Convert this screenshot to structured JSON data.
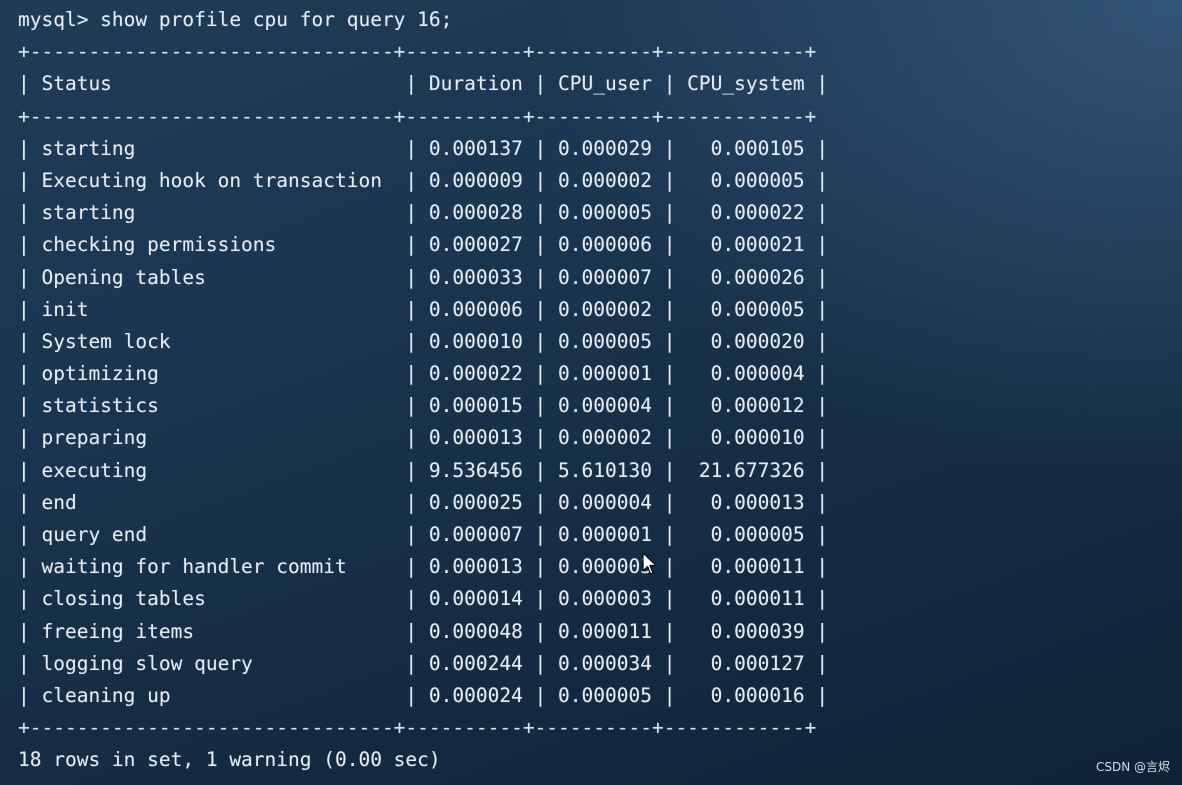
{
  "prompt_line": "mysql> show profile cpu for query 16;",
  "table": {
    "border": "+-------------------------------+----------+----------+------------+",
    "header": "| Status                         | Duration | CPU_user | CPU_system |",
    "rows": [
      "| starting                       | 0.000137 | 0.000029 |   0.000105 |",
      "| Executing hook on transaction  | 0.000009 | 0.000002 |   0.000005 |",
      "| starting                       | 0.000028 | 0.000005 |   0.000022 |",
      "| checking permissions           | 0.000027 | 0.000006 |   0.000021 |",
      "| Opening tables                 | 0.000033 | 0.000007 |   0.000026 |",
      "| init                           | 0.000006 | 0.000002 |   0.000005 |",
      "| System lock                    | 0.000010 | 0.000005 |   0.000020 |",
      "| optimizing                     | 0.000022 | 0.000001 |   0.000004 |",
      "| statistics                     | 0.000015 | 0.000004 |   0.000012 |",
      "| preparing                      | 0.000013 | 0.000002 |   0.000010 |",
      "| executing                      | 9.536456 | 5.610130 |  21.677326 |",
      "| end                            | 0.000025 | 0.000004 |   0.000013 |",
      "| query end                      | 0.000007 | 0.000001 |   0.000005 |",
      "| waiting for handler commit     | 0.000013 | 0.000003 |   0.000011 |",
      "| closing tables                 | 0.000014 | 0.000003 |   0.000011 |",
      "| freeing items                  | 0.000048 | 0.000011 |   0.000039 |",
      "| logging slow query             | 0.000244 | 0.000034 |   0.000127 |",
      "| cleaning up                    | 0.000024 | 0.000005 |   0.000016 |"
    ]
  },
  "result_line": "18 rows in set, 1 warning (0.00 sec)",
  "watermark": "CSDN @言烬"
}
